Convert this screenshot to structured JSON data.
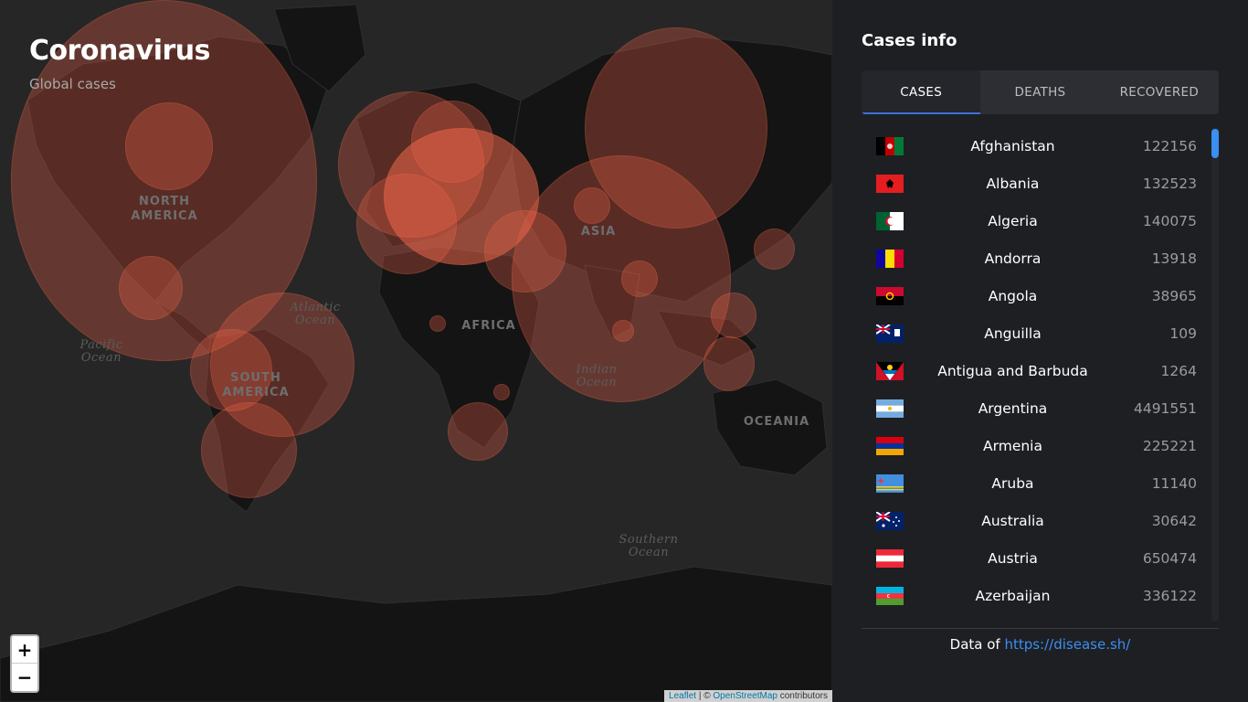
{
  "map": {
    "title": "Coronavirus",
    "subtitle": "Global cases",
    "continent_labels": [
      {
        "text": "NORTH AMERICA"
      },
      {
        "text": "SOUTH AMERICA"
      },
      {
        "text": "AFRICA"
      },
      {
        "text": "ASIA"
      },
      {
        "text": "OCEANIA"
      }
    ],
    "ocean_labels": [
      {
        "text": "Atlantic Ocean"
      },
      {
        "text": "Pacific Ocean"
      },
      {
        "text": "Indian Ocean"
      },
      {
        "text": "Southern Ocean"
      }
    ],
    "zoom_in_label": "+",
    "zoom_out_label": "−",
    "attribution": {
      "leaflet": "Leaflet",
      "sep": " | © ",
      "osm": "OpenStreetMap",
      "suffix": " contributors"
    },
    "bubble_color": "#e86046"
  },
  "panel": {
    "title": "Cases info",
    "tabs": [
      {
        "label": "CASES",
        "active": true
      },
      {
        "label": "DEATHS",
        "active": false
      },
      {
        "label": "RECOVERED",
        "active": false
      }
    ],
    "countries": [
      {
        "name": "Afghanistan",
        "count": "122156",
        "flag": "afghanistan-flag"
      },
      {
        "name": "Albania",
        "count": "132523",
        "flag": "albania-flag"
      },
      {
        "name": "Algeria",
        "count": "140075",
        "flag": "algeria-flag"
      },
      {
        "name": "Andorra",
        "count": "13918",
        "flag": "andorra-flag"
      },
      {
        "name": "Angola",
        "count": "38965",
        "flag": "angola-flag"
      },
      {
        "name": "Anguilla",
        "count": "109",
        "flag": "anguilla-flag"
      },
      {
        "name": "Antigua and Barbuda",
        "count": "1264",
        "flag": "antigua-flag"
      },
      {
        "name": "Argentina",
        "count": "4491551",
        "flag": "argentina-flag"
      },
      {
        "name": "Armenia",
        "count": "225221",
        "flag": "armenia-flag"
      },
      {
        "name": "Aruba",
        "count": "11140",
        "flag": "aruba-flag"
      },
      {
        "name": "Australia",
        "count": "30642",
        "flag": "australia-flag"
      },
      {
        "name": "Austria",
        "count": "650474",
        "flag": "austria-flag"
      },
      {
        "name": "Azerbaijan",
        "count": "336122",
        "flag": "azerbaijan-flag"
      }
    ],
    "footer": {
      "prefix": "Data of ",
      "link": "https://disease.sh/"
    },
    "accent_color": "#3a8ff0",
    "tab_indicator_color": "#3f6fd8"
  }
}
